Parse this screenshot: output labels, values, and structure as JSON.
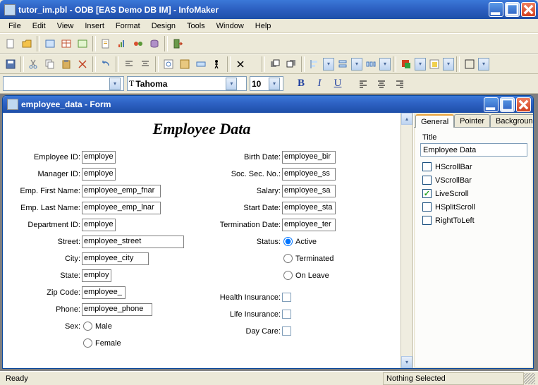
{
  "main_window": {
    "title": "tutor_im.pbl - ODB [EAS Demo DB IM]  - InfoMaker"
  },
  "menu": {
    "items": [
      "File",
      "Edit",
      "View",
      "Insert",
      "Format",
      "Design",
      "Tools",
      "Window",
      "Help"
    ]
  },
  "fontbar": {
    "style_value": "",
    "font_name": "Tahoma",
    "font_size": "10"
  },
  "child_window": {
    "title": "employee_data - Form"
  },
  "form": {
    "heading": "Employee Data",
    "left": {
      "employee_id": {
        "label": "Employee ID:",
        "value": "employe"
      },
      "manager_id": {
        "label": "Manager ID:",
        "value": "employe"
      },
      "emp_first_name": {
        "label": "Emp. First Name:",
        "value": "employee_emp_fnar"
      },
      "emp_last_name": {
        "label": "Emp. Last Name:",
        "value": "employee_emp_lnar"
      },
      "department_id": {
        "label": "Department ID:",
        "value": "employe"
      },
      "street": {
        "label": "Street:",
        "value": "employee_street"
      },
      "city": {
        "label": "City:",
        "value": "employee_city"
      },
      "state": {
        "label": "State:",
        "value": "employ"
      },
      "zip_code": {
        "label": "Zip Code:",
        "value": "employee_"
      },
      "phone": {
        "label": "Phone:",
        "value": "employee_phone"
      },
      "sex": {
        "label": "Sex:",
        "option1": "Male",
        "option2": "Female"
      }
    },
    "right": {
      "birth_date": {
        "label": "Birth Date:",
        "value": "employee_bir"
      },
      "ssn": {
        "label": "Soc. Sec. No.:",
        "value": "employee_ss"
      },
      "salary": {
        "label": "Salary:",
        "value": "employee_sa"
      },
      "start_date": {
        "label": "Start Date:",
        "value": "employee_sta"
      },
      "term_date": {
        "label": "Termination Date:",
        "value": "employee_ter"
      },
      "status": {
        "label": "Status:",
        "active": "Active",
        "terminated": "Terminated",
        "onleave": "On Leave"
      },
      "health_ins": {
        "label": "Health Insurance:"
      },
      "life_ins": {
        "label": "Life Insurance:"
      },
      "day_care": {
        "label": "Day Care:"
      }
    }
  },
  "props": {
    "tabs": {
      "general": "General",
      "pointer": "Pointer",
      "background": "Background"
    },
    "title_label": "Title",
    "title_value": "Employee Data",
    "checks": {
      "hscroll": "HScrollBar",
      "vscroll": "VScrollBar",
      "livescroll": "LiveScroll",
      "hsplit": "HSplitScroll",
      "rtl": "RightToLeft"
    }
  },
  "status": {
    "ready": "Ready",
    "selection": "Nothing Selected"
  }
}
